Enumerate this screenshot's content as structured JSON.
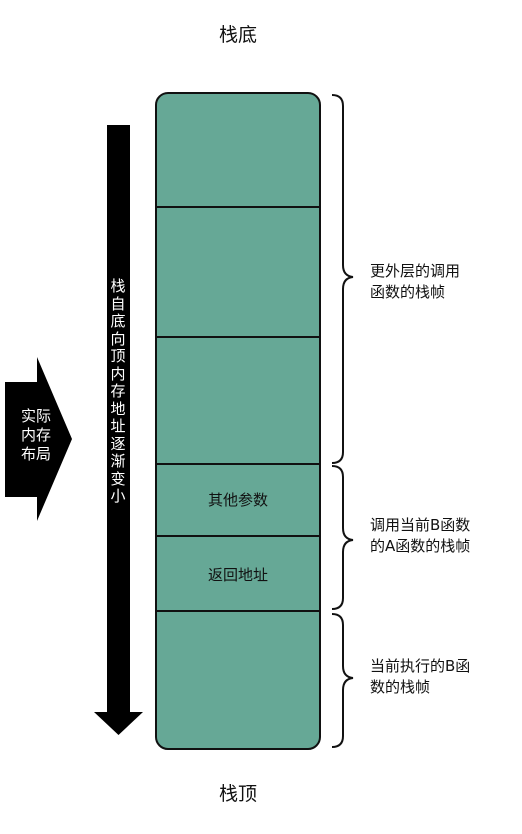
{
  "stack_bottom_label": "栈底",
  "stack_top_label": "栈顶",
  "memory_layout_label": "实际\n内存\n布局",
  "direction_label": "栈\n自\n底\n向\n顶\n内\n存\n地\n址\n逐\n渐\n变\n小",
  "frames": [
    {
      "label": ""
    },
    {
      "label": ""
    },
    {
      "label": ""
    },
    {
      "label": "其他参数"
    },
    {
      "label": "返回地址"
    },
    {
      "label": ""
    }
  ],
  "braces": [
    {
      "label": "更外层的调用\n函数的栈帧"
    },
    {
      "label": "调用当前B函数\n的A函数的栈帧"
    },
    {
      "label": "当前执行的B函\n数的栈帧"
    }
  ],
  "colors": {
    "frame_fill": "#66a896",
    "outline": "#111111",
    "arrow": "#000000"
  }
}
